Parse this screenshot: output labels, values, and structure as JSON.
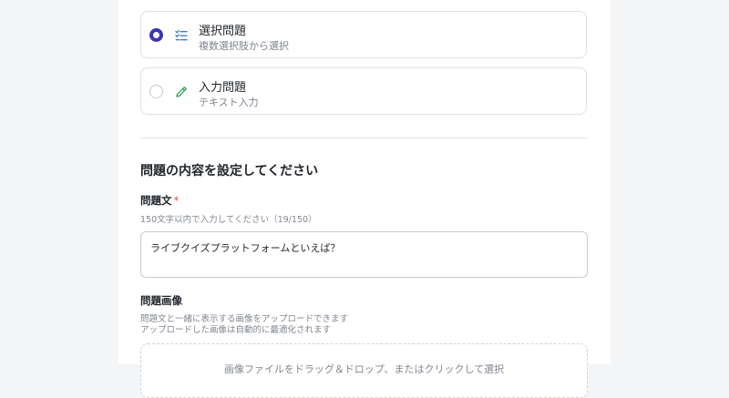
{
  "question_types": [
    {
      "title": "選択問題",
      "subtitle": "複数選択肢から選択",
      "icon": "checklist-icon",
      "selected": true
    },
    {
      "title": "入力問題",
      "subtitle": "テキスト入力",
      "icon": "pencil-icon",
      "selected": false
    }
  ],
  "section": {
    "title": "問題の内容を設定してください"
  },
  "question_text": {
    "label": "問題文",
    "required_mark": "*",
    "hint": "150文字以内で入力してください（19/150）",
    "value": "ライブクイズプラットフォームといえば？"
  },
  "question_image": {
    "label": "問題画像",
    "hint_line1": "問題文と一緒に表示する画像をアップロードできます",
    "hint_line2": "アップロードした画像は自動的に最適化されます",
    "dropzone_text": "画像ファイルをドラッグ＆ドロップ、またはクリックして選択"
  },
  "colors": {
    "accent": "#3b34b5",
    "checklist_icon": "#3a7bd5",
    "pencil_icon": "#2e9e4f",
    "required": "#e5484d"
  }
}
